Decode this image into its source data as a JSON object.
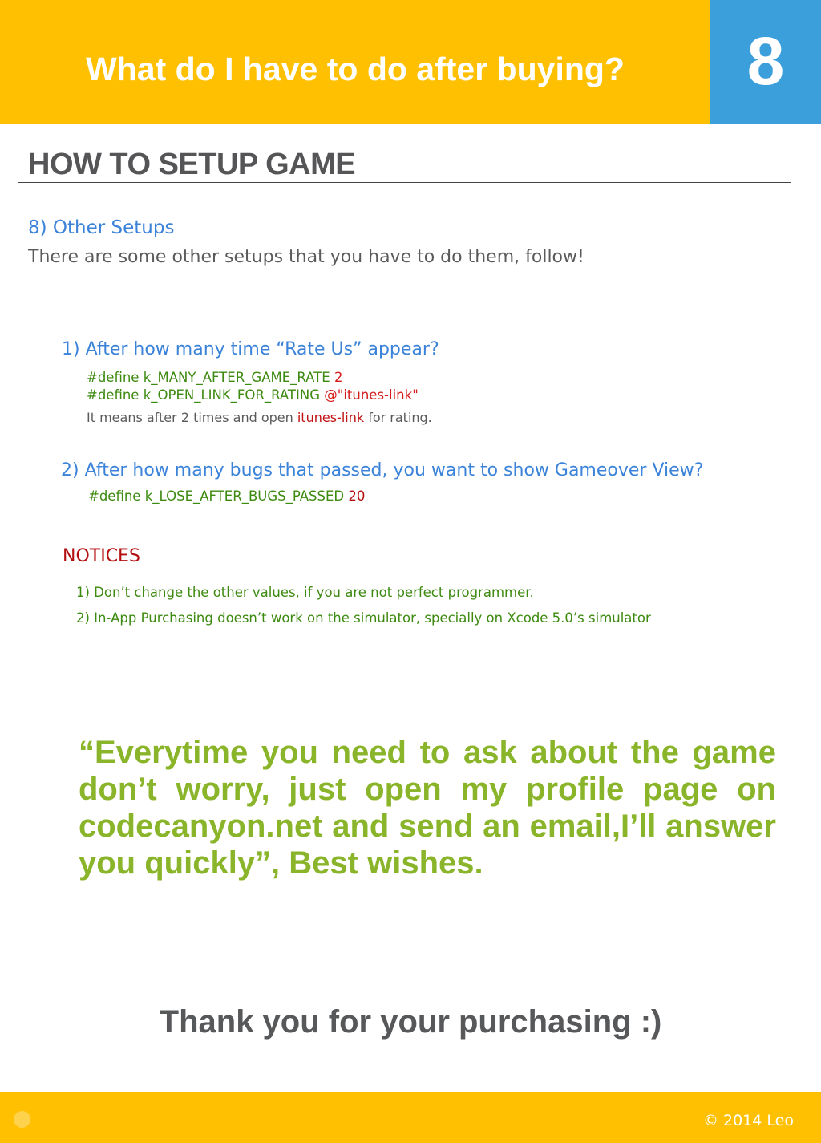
{
  "header": {
    "title": "What do I have to do after buying?",
    "page_number": "8",
    "colors": {
      "header_bg": "#fec000",
      "page_number_bg": "#3a9fdb"
    }
  },
  "section": {
    "title": "HOW TO SETUP GAME"
  },
  "content": {
    "subhead": "8) Other Setups",
    "intro": "There are some other setups that you have to do them, follow!",
    "q1": {
      "question": "1) After how many time “Rate Us” appear?",
      "code": [
        {
          "text": "#define k_MANY_AFTER_GAME_RATE",
          "value": "2"
        },
        {
          "text": "#define k_OPEN_LINK_FOR_RATING",
          "value": "@\"itunes-link\""
        }
      ],
      "explanation": {
        "before": "It means after 2 times and open ",
        "highlight": "itunes-link",
        "after": " for rating."
      }
    },
    "q2": {
      "question": "2) After how many bugs that passed, you want to show Gameover View?",
      "code": [
        {
          "text": "#define k_LOSE_AFTER_BUGS_PASSED",
          "value": "20"
        }
      ]
    },
    "notices": {
      "title": "NOTICES",
      "items": [
        "1) Don’t change the other values, if you are not perfect programmer.",
        "2) In-App Purchasing doesn’t work on the simulator, specially on Xcode 5.0’s simulator"
      ]
    },
    "quote_lines": [
      "“Everytime you need to ask about the game",
      "don’t worry, just open my profile page on",
      "codecanyon.net and send an email,I’ll answer",
      "you quickly”, Best wishes."
    ],
    "thanks": "Thank you for your purchasing :)"
  },
  "footer": {
    "copyright": "© 2014 Leo"
  }
}
